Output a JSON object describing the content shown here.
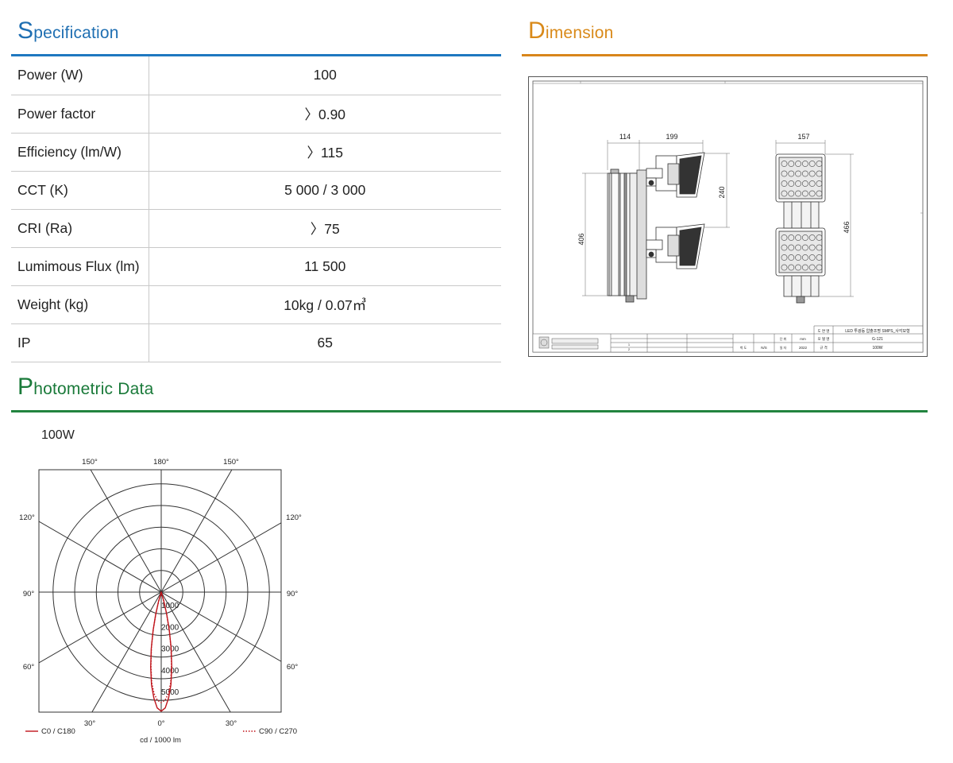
{
  "specification": {
    "title_cap": "S",
    "title_rest": "pecification",
    "rows": [
      {
        "label": "Power (W)",
        "value": "100"
      },
      {
        "label": "Power factor",
        "value": "〉0.90"
      },
      {
        "label": "Efficiency (lm/W)",
        "value": "〉115"
      },
      {
        "label": "CCT (K)",
        "value": "5 000 / 3 000"
      },
      {
        "label": "CRI (Ra)",
        "value": "〉75"
      },
      {
        "label": "Lumimous Flux (lm)",
        "value": "11 500"
      },
      {
        "label": "Weight (kg)",
        "value": "10kg / 0.07㎥"
      },
      {
        "label": "IP",
        "value": "65"
      }
    ]
  },
  "dimension": {
    "title_cap": "D",
    "title_rest": "imension",
    "labels": {
      "w114": "114",
      "w199": "199",
      "w157": "157",
      "h240": "240",
      "h406": "406",
      "h466": "466"
    },
    "title_block": {
      "drawing_label": "도 면 명",
      "drawing_name": "LED 투광등 압출조명 SMPS_사각모형",
      "model_label": "모 델 명",
      "model_value": "G-121",
      "spec_label": "규 격",
      "spec_value": "100W",
      "unit_label": "단 위",
      "unit_value": "mm",
      "scale_label": "척 도",
      "scale_value": "N/S",
      "date_label": "일 자",
      "date_value": "2022",
      "rev_1": "1",
      "rev_2": "2"
    }
  },
  "photometric": {
    "title_cap": "P",
    "title_rest": "hotometric Data",
    "chart_data": {
      "type": "polar",
      "title": "100W",
      "unit_label": "cd / 1000 lm",
      "angle_labels": {
        "top": [
          "150°",
          "180°",
          "150°"
        ],
        "upper_side": [
          "120°",
          "120°"
        ],
        "middle_side": [
          "90°",
          "90°"
        ],
        "lower_side": [
          "60°",
          "60°"
        ],
        "bottom": [
          "30°",
          "0°",
          "30°"
        ]
      },
      "radial_ticks": [
        1000,
        2000,
        3000,
        4000,
        5000
      ],
      "radial_max": 5800,
      "series": [
        {
          "name": "C0 / C180",
          "color": "#c0141b",
          "style": "solid",
          "angles": [
            0,
            2,
            4,
            6,
            8,
            10,
            12,
            14,
            16,
            18
          ],
          "values": [
            5500,
            5350,
            4900,
            4300,
            3500,
            2650,
            1800,
            1050,
            450,
            0
          ]
        },
        {
          "name": "C90 / C270",
          "color": "#c0141b",
          "style": "dotted",
          "angles": [
            0,
            2,
            4,
            6,
            8,
            10,
            12,
            14,
            16,
            18
          ],
          "values": [
            5100,
            5000,
            4700,
            4200,
            3400,
            2600,
            1750,
            1000,
            400,
            0
          ]
        }
      ]
    }
  }
}
